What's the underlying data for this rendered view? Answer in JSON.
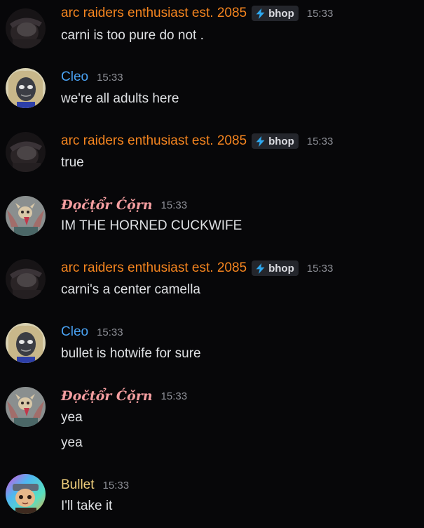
{
  "messages": [
    {
      "username": "arc raiders enthusiast est. 2085",
      "tag": "bhop",
      "time": "15:33",
      "lines": [
        "carni is too pure do not ."
      ]
    },
    {
      "username": "Cleo",
      "time": "15:33",
      "lines": [
        "we're all adults here"
      ]
    },
    {
      "username": "arc raiders enthusiast est. 2085",
      "tag": "bhop",
      "time": "15:33",
      "lines": [
        "true"
      ]
    },
    {
      "username": "Ɖọčṭổr Ćọ̌ṛn",
      "time": "15:33",
      "lines": [
        "IM THE HORNED CUCKWIFE"
      ]
    },
    {
      "username": "arc raiders enthusiast est. 2085",
      "tag": "bhop",
      "time": "15:33",
      "lines": [
        "carni's a center camella"
      ]
    },
    {
      "username": "Cleo",
      "time": "15:33",
      "lines": [
        "bullet is hotwife for sure"
      ]
    },
    {
      "username": "Ɖọčṭổr Ćọ̌ṛn",
      "time": "15:33",
      "lines": [
        "yea",
        "yea"
      ]
    },
    {
      "username": "Bullet",
      "time": "15:33",
      "lines": [
        "I'll take it"
      ]
    }
  ],
  "colors": {
    "background": "#070709",
    "username_arc": "#f5851f",
    "username_cleo": "#4aa3f4",
    "username_doctor": "#f49ea0",
    "username_bullet": "#f0cf7c",
    "tag_icon": "#2ea8ef"
  },
  "icons": {
    "tag_icon": "lightning-bolt-icon"
  }
}
